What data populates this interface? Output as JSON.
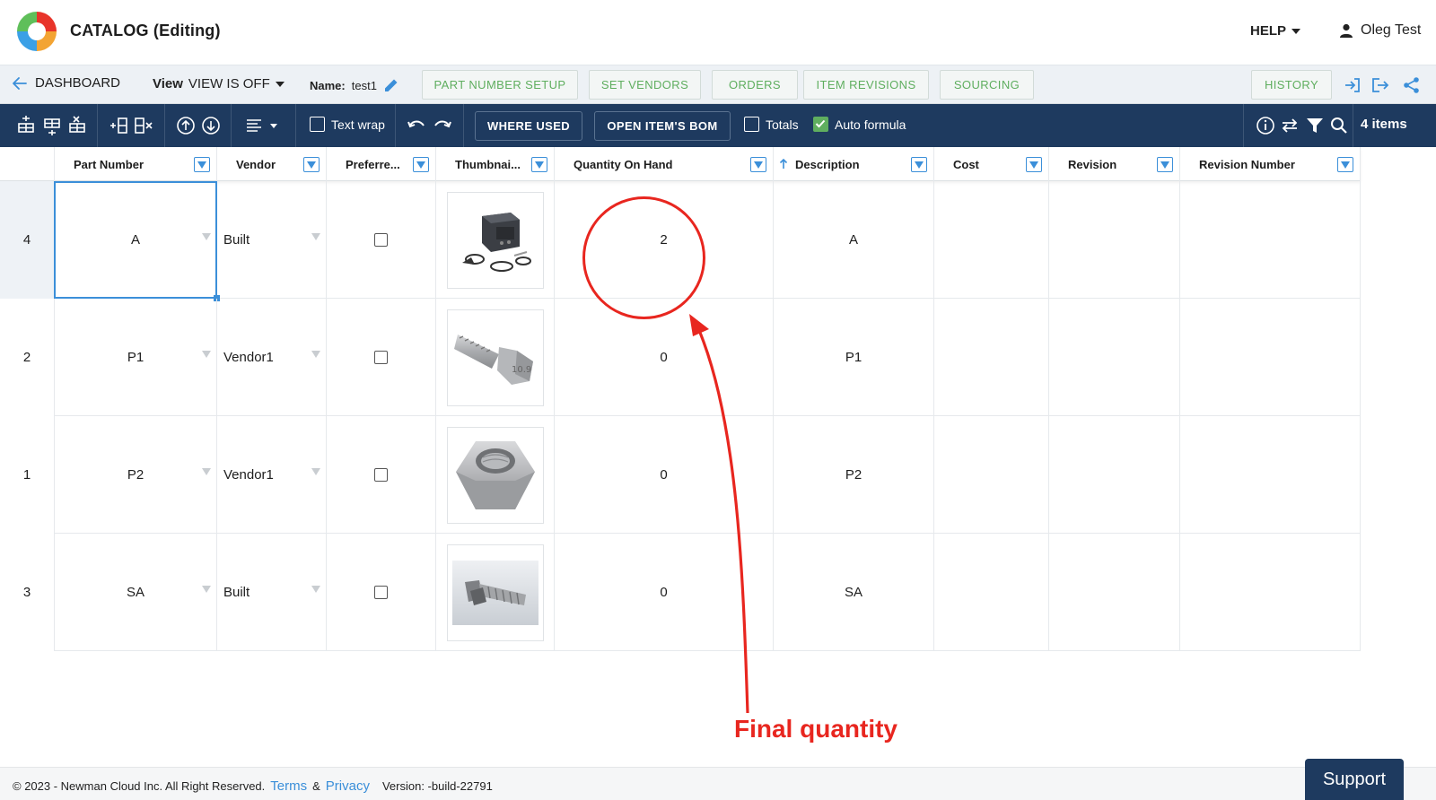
{
  "header": {
    "title": "CATALOG (Editing)",
    "help_label": "HELP",
    "user_name": "Oleg Test"
  },
  "nav": {
    "back_label": "DASHBOARD",
    "view_label": "View",
    "view_value": "VIEW IS OFF",
    "name_label": "Name:",
    "name_value": "test1",
    "tabs": [
      {
        "label": "PART NUMBER SETUP"
      },
      {
        "label": "SET VENDORS"
      },
      {
        "label": "ORDERS"
      },
      {
        "label": "ITEM REVISIONS"
      },
      {
        "label": "SOURCING"
      }
    ],
    "history_label": "HISTORY"
  },
  "toolbar": {
    "text_wrap_label": "Text wrap",
    "where_used_label": "WHERE USED",
    "open_bom_label": "OPEN ITEM'S BOM",
    "totals_label": "Totals",
    "auto_formula_label": "Auto formula",
    "auto_formula_checked": true,
    "items_count": "4 items"
  },
  "grid": {
    "columns": [
      "Part Number",
      "Vendor",
      "Preferre...",
      "Thumbnai...",
      "Quantity On Hand",
      "Description",
      "Cost",
      "Revision",
      "Revision Number"
    ],
    "sorted_column": "Description",
    "rows": [
      {
        "row_num": "4",
        "part_number": "A",
        "vendor": "Built",
        "quantity": "2",
        "description": "A",
        "thumbnail": "welder-kit-image"
      },
      {
        "row_num": "2",
        "part_number": "P1",
        "vendor": "Vendor1",
        "quantity": "0",
        "description": "P1",
        "thumbnail": "hex-bolt-image"
      },
      {
        "row_num": "1",
        "part_number": "P2",
        "vendor": "Vendor1",
        "quantity": "0",
        "description": "P2",
        "thumbnail": "hex-nut-image"
      },
      {
        "row_num": "3",
        "part_number": "SA",
        "vendor": "Built",
        "quantity": "0",
        "description": "SA",
        "thumbnail": "bolt-assembly-image"
      }
    ]
  },
  "annotation": {
    "label": "Final quantity",
    "color": "#e8261f"
  },
  "footer": {
    "copyright": "© 2023 - Newman Cloud Inc. All Right Reserved.",
    "terms_label": "Terms",
    "amp": "&",
    "privacy_label": "Privacy",
    "version": "Version: -build-22791",
    "support_label": "Support"
  },
  "colors": {
    "toolbar_bg": "#1e3a5f",
    "accent_green": "#5fae5f",
    "accent_blue": "#3b8fd9"
  }
}
